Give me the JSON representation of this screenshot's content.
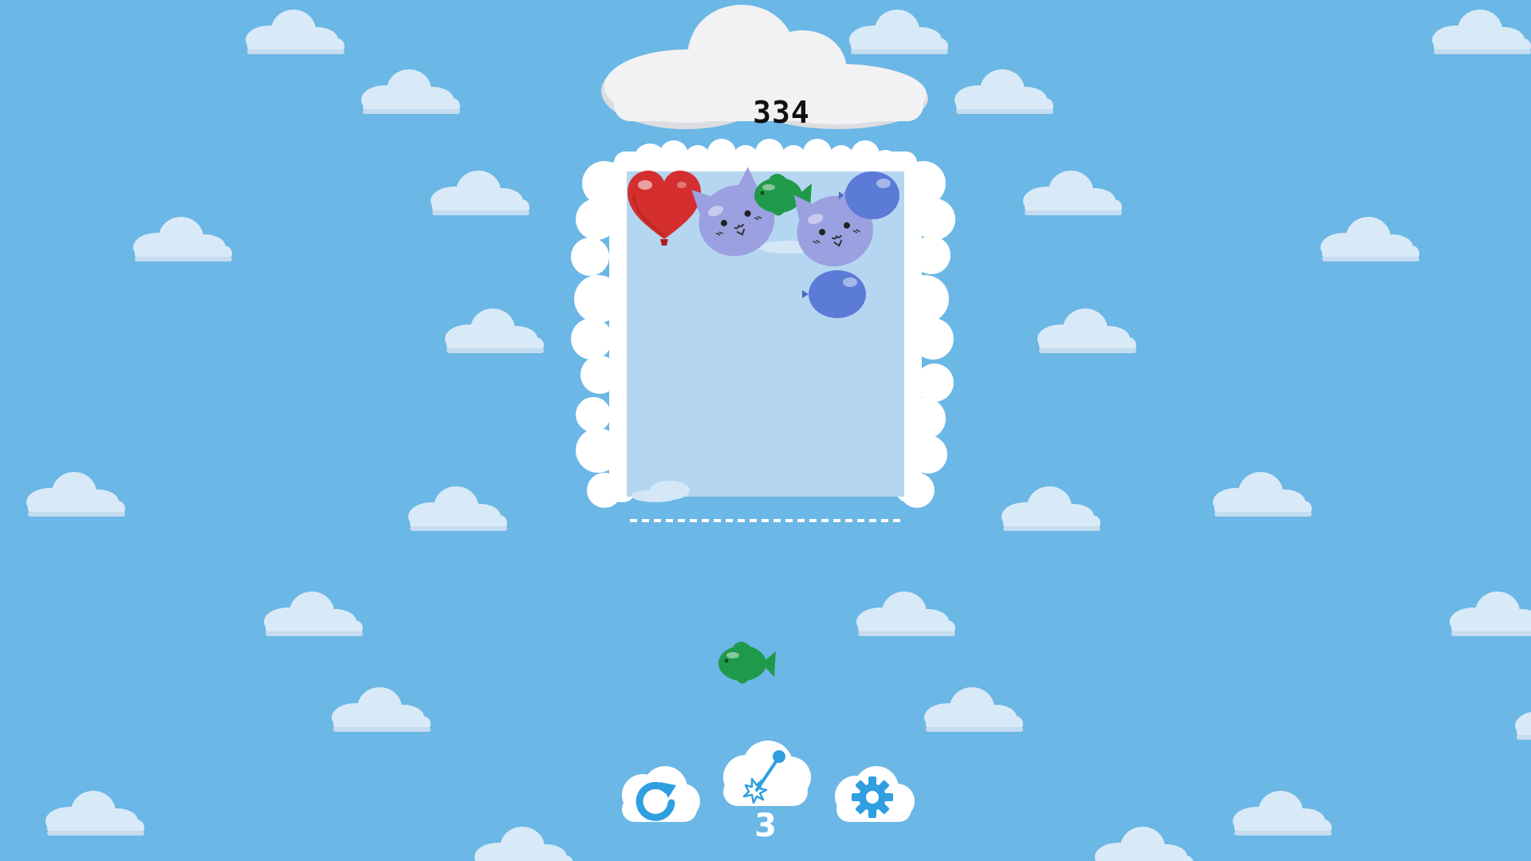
{
  "game": {
    "score": "334",
    "bomb_count": "3"
  },
  "icons": {
    "restart": "restart-icon",
    "bomb": "pin-pop-icon",
    "settings": "gear-icon"
  },
  "colors": {
    "sky": "#6bb7e6",
    "cloud": "#f4f4f6",
    "container": "#b5d6f0",
    "button_accent": "#2f9fe0",
    "heart": "#d42e2e",
    "cat": "#9ba0e0",
    "fish": "#1f9a4a",
    "round_balloon": "#5b7bd6"
  },
  "balloons": [
    {
      "type": "heart",
      "color": "red"
    },
    {
      "type": "cat",
      "color": "lavender"
    },
    {
      "type": "fish",
      "color": "green"
    },
    {
      "type": "cat",
      "color": "lavender"
    },
    {
      "type": "round",
      "color": "blue"
    },
    {
      "type": "round",
      "color": "blue"
    }
  ],
  "next_balloon": {
    "type": "fish",
    "color": "green"
  }
}
